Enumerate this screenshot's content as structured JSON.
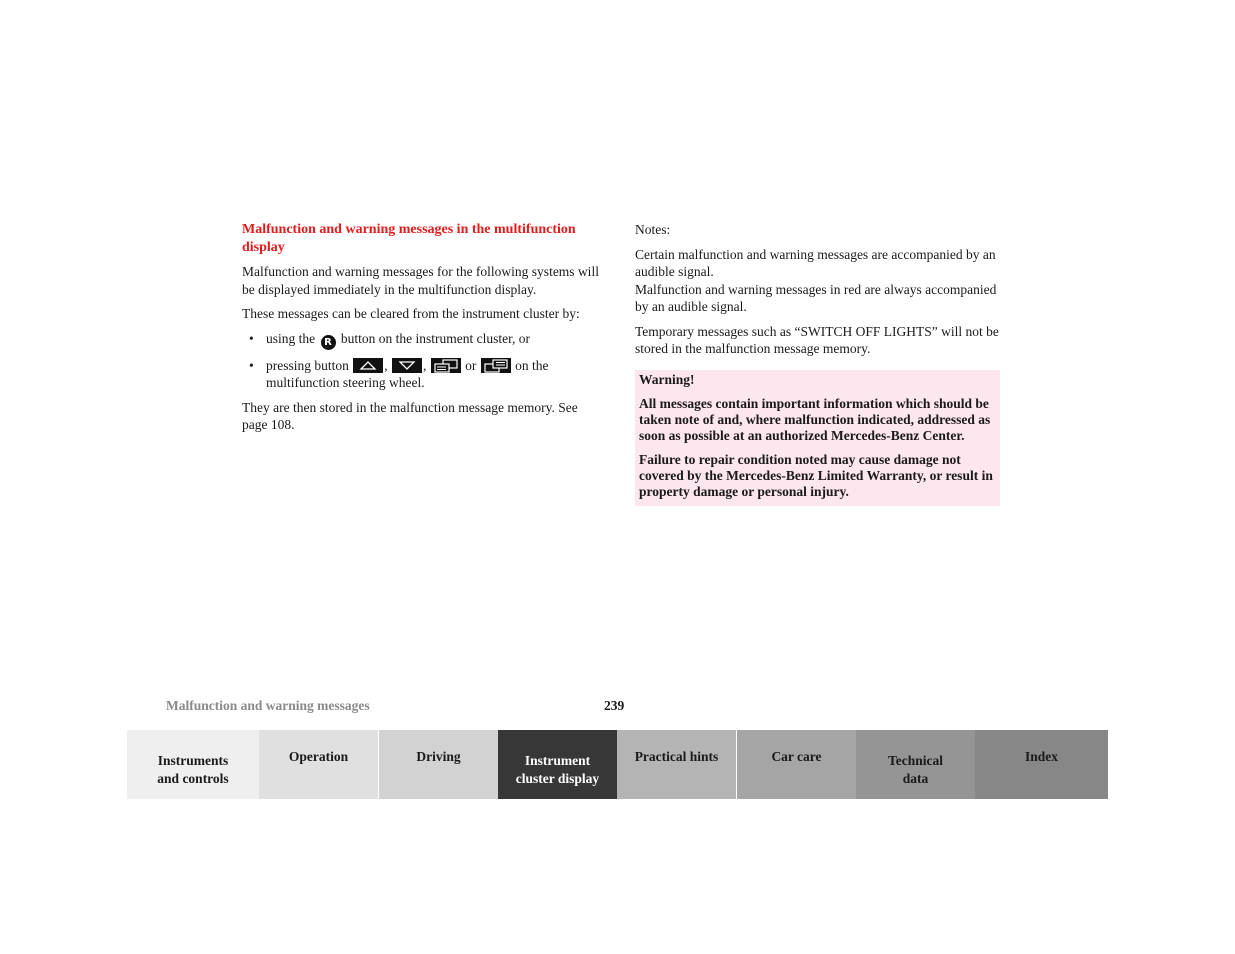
{
  "left_column": {
    "heading": "Malfunction and warning messages in the multifunction display",
    "para1": "Malfunction and warning messages for the following systems will be displayed immediately in the multifunction display.",
    "para2": "These messages can be cleared from the instrument cluster by:",
    "bullet1": {
      "before": "using the",
      "icon_label": "R",
      "after": "button on the instrument cluster, or"
    },
    "bullet2": {
      "before": "pressing button",
      "sep1": ",",
      "sep2": ",",
      "or": "or",
      "after": "on the multifunction steering wheel."
    },
    "para3": "They are then stored in the malfunction message memory. See page 108."
  },
  "right_column": {
    "notes_label": "Notes:",
    "note1a": "Certain malfunction and warning messages are accompanied by an audible signal.",
    "note1b": "Malfunction and warning messages in red are always accompanied by an audible signal.",
    "note2": "Temporary messages such as “SWITCH OFF LIGHTS” will not be stored in the malfunction message memory.",
    "warning": {
      "title": "Warning!",
      "para1": "All messages contain important information which should be taken note of and, where malfunction indicated, addressed as soon as possible at an authorized Mercedes-Benz Center.",
      "para2": "Failure to repair condition noted may cause damage not covered by the Mercedes-Benz Limited Warranty, or result in property damage or personal injury."
    }
  },
  "footer": {
    "section_title": "Malfunction and warning messages",
    "page_number": "239"
  },
  "nav_tabs": [
    {
      "label_line1": "Instruments",
      "label_line2": "and controls",
      "bg": "#efefef",
      "fg": "#1a1a1a"
    },
    {
      "label_line1": "Operation",
      "label_line2": "",
      "bg": "#e0e0e0",
      "fg": "#1a1a1a"
    },
    {
      "label_line1": "Driving",
      "label_line2": "",
      "bg": "#d2d2d2",
      "fg": "#1a1a1a"
    },
    {
      "label_line1": "Instrument",
      "label_line2": "cluster display",
      "bg": "#373737",
      "fg": "#ffffff",
      "active": true
    },
    {
      "label_line1": "Practical hints",
      "label_line2": "",
      "bg": "#b4b4b4",
      "fg": "#1a1a1a"
    },
    {
      "label_line1": "Car care",
      "label_line2": "",
      "bg": "#a5a5a5",
      "fg": "#1a1a1a"
    },
    {
      "label_line1": "Technical",
      "label_line2": "data",
      "bg": "#959595",
      "fg": "#1a1a1a"
    },
    {
      "label_line1": "Index",
      "label_line2": "",
      "bg": "#878787",
      "fg": "#1a1a1a"
    }
  ],
  "icons": {
    "reset": "reset-button-icon",
    "up": "arrow-up-button-icon",
    "down": "arrow-down-button-icon",
    "prev": "display-previous-button-icon",
    "next": "display-next-button-icon"
  }
}
